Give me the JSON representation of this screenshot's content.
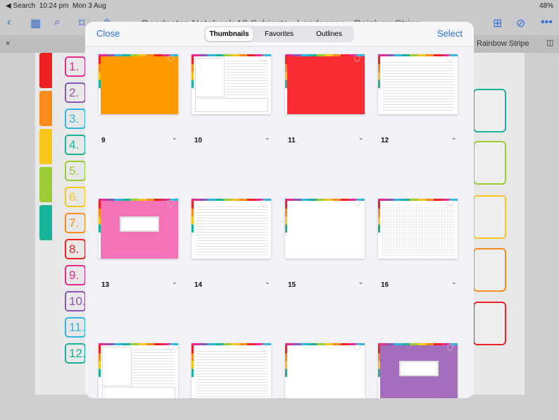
{
  "status": {
    "back": "◀ Search",
    "time": "10:24 pm",
    "date": "Mon 3 Aug",
    "battery": "48%"
  },
  "toolbar": {
    "title": "Goodnotes Notebook 12 Subjects - Landscape - Rainbow Stripe",
    "tab_title": "Rainbow Stripe"
  },
  "page": {
    "numbers": [
      "1.",
      "2.",
      "3.",
      "4.",
      "5.",
      "6.",
      "7.",
      "8.",
      "9.",
      "10.",
      "11.",
      "12."
    ],
    "colors": [
      "#e8298c",
      "#8e55b4",
      "#30b5e0",
      "#18b39a",
      "#9ccc34",
      "#f8c51c",
      "#f98b1c",
      "#e22",
      "#e8298c",
      "#8e55b4",
      "#30b5e0",
      "#18b39a"
    ],
    "tab_colors": [
      "#e22",
      "#f98b1c",
      "#f8c51c",
      "#9ccc34",
      "#18b39a"
    ]
  },
  "modal": {
    "close": "Close",
    "select": "Select",
    "segments": [
      "Thumbnails",
      "Favorites",
      "Outlines"
    ],
    "active_segment": "Thumbnails",
    "thumbnails": [
      {
        "page": "9",
        "style": "orange"
      },
      {
        "page": "10",
        "style": "cornell"
      },
      {
        "page": "11",
        "style": "red"
      },
      {
        "page": "12",
        "style": "lined"
      },
      {
        "page": "13",
        "style": "pink-cover"
      },
      {
        "page": "14",
        "style": "lined"
      },
      {
        "page": "15",
        "style": "blank"
      },
      {
        "page": "16",
        "style": "grid"
      },
      {
        "page": "",
        "style": "cornell"
      },
      {
        "page": "",
        "style": "lined"
      },
      {
        "page": "",
        "style": "blank"
      },
      {
        "page": "",
        "style": "purple-cover"
      }
    ]
  }
}
